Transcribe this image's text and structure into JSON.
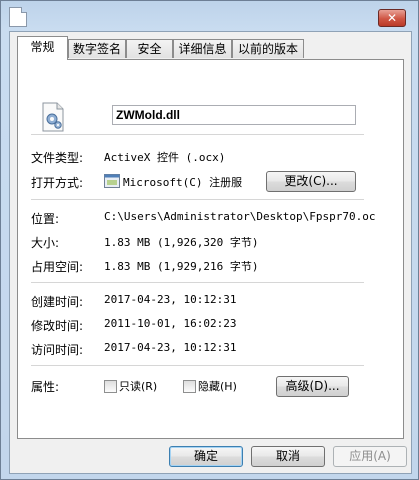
{
  "window": {
    "close_label": "✕"
  },
  "tabs": [
    {
      "label": "常规",
      "active": true
    },
    {
      "label": "数字签名"
    },
    {
      "label": "安全"
    },
    {
      "label": "详细信息"
    },
    {
      "label": "以前的版本"
    }
  ],
  "general": {
    "file_icon": "dll-settings-icon",
    "filename": "ZWMold.dll",
    "file_type_label": "文件类型:",
    "file_type_value": "ActiveX 控件 (.ocx)",
    "opens_with_label": "打开方式:",
    "opens_with_icon": "app-icon",
    "opens_with_value": "Microsoft(C) 注册服",
    "change_button": "更改(C)...",
    "location_label": "位置:",
    "location_value": "C:\\Users\\Administrator\\Desktop\\Fpspr70.oc",
    "size_label": "大小:",
    "size_value": "1.83 MB (1,926,320 字节)",
    "size_on_disk_label": "占用空间:",
    "size_on_disk_value": "1.83 MB (1,929,216 字节)",
    "created_label": "创建时间:",
    "created_value": "2017-04-23, 10:12:31",
    "modified_label": "修改时间:",
    "modified_value": "2011-10-01, 16:02:23",
    "accessed_label": "访问时间:",
    "accessed_value": "2017-04-23, 10:12:31",
    "attributes_label": "属性:",
    "readonly_label": "只读(R)",
    "hidden_label": "隐藏(H)",
    "advanced_button": "高级(D)..."
  },
  "footer": {
    "ok": "确定",
    "cancel": "取消",
    "apply": "应用(A)"
  }
}
